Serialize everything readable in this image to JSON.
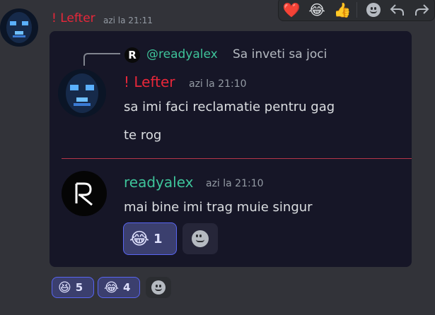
{
  "outer": {
    "author": "! Lefter",
    "timestamp": "azi la 21:11"
  },
  "toolbar": {
    "reactions": [
      "❤️",
      "😂",
      "👍"
    ]
  },
  "embed": {
    "reply": {
      "mention": "@readyalex",
      "text": "Sa inveti sa joci"
    },
    "quoted": {
      "author": "! Lefter",
      "timestamp": "azi la 21:10",
      "lines": [
        "sa imi faci reclamatie pentru gag",
        "te rog"
      ]
    },
    "reply_msg": {
      "author": "readyalex",
      "timestamp": "azi la 21:10",
      "text": "mai bine imi trag muie singur",
      "reaction": {
        "emoji": "😂",
        "count": "1"
      }
    }
  },
  "reactions": [
    {
      "emoji": "😆",
      "count": "5"
    },
    {
      "emoji": "😂",
      "count": "4"
    }
  ],
  "colors": {
    "author_red": "#e8273a",
    "author_green": "#3ec49a",
    "mention_green": "#3ec49a",
    "accent": "#5865f2"
  }
}
